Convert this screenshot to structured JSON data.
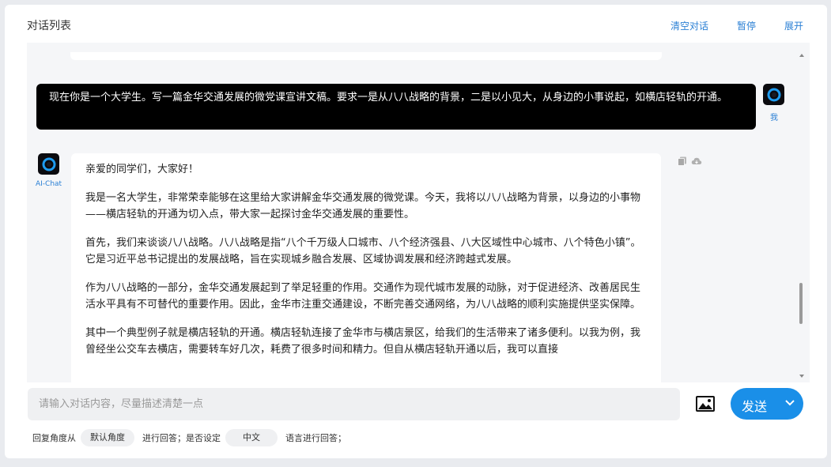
{
  "header": {
    "title": "对话列表",
    "clear_label": "清空对话",
    "pause_label": "暂停",
    "expand_label": "展开"
  },
  "chat": {
    "user": {
      "name": "我",
      "message": "现在你是一个大学生。写一篇金华交通发展的微党课宣讲文稿。要求一是从八八战略的背景，二是以小见大，从身边的小事说起，如横店轻轨的开通。"
    },
    "assistant": {
      "name": "AI-Chat",
      "paragraphs": [
        "亲爱的同学们，大家好！",
        "我是一名大学生，非常荣幸能够在这里给大家讲解金华交通发展的微党课。今天，我将以八八战略为背景，以身边的小事物——横店轻轨的开通为切入点，带大家一起探讨金华交通发展的重要性。",
        "首先，我们来谈谈八八战略。八八战略是指“八个千万级人口城市、八个经济强县、八大区域性中心城市、八个特色小镇”。它是习近平总书记提出的发展战略，旨在实现城乡融合发展、区域协调发展和经济跨越式发展。",
        "作为八八战略的一部分，金华交通发展起到了举足轻重的作用。交通作为现代城市发展的动脉，对于促进经济、改善居民生活水平具有不可替代的重要作用。因此，金华市注重交通建设，不断完善交通网络，为八八战略的顺利实施提供坚实保障。",
        "其中一个典型例子就是横店轻轨的开通。横店轻轨连接了金华市与横店景区，给我们的生活带来了诸多便利。以我为例，我曾经坐公交车去横店，需要转车好几次，耗费了很多时间和精力。但自从横店轻轨开通以后，我可以直接"
      ]
    }
  },
  "composer": {
    "placeholder": "请输入对话内容，尽量描述清楚一点",
    "send_label": "发送"
  },
  "options": {
    "prefix": "回复角度从",
    "angle": "默认角度",
    "middle": "进行回答；是否设定",
    "language": "中文",
    "suffix": "语言进行回答；"
  }
}
